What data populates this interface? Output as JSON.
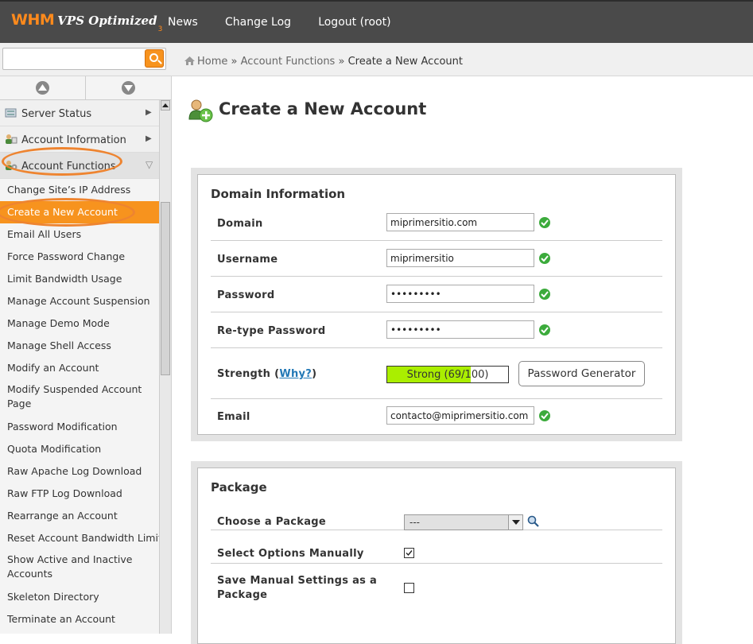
{
  "header": {
    "logo_main": "WHM",
    "logo_sub": "VPS Optimized",
    "logo_ver": "3",
    "nav": [
      "News",
      "Change Log",
      "Logout (root)"
    ]
  },
  "search": {
    "value": "",
    "placeholder": ""
  },
  "breadcrumb": {
    "home": "Home",
    "sep": "»",
    "section": "Account Functions",
    "current": "Create a New Account"
  },
  "sidebar": {
    "sections": [
      {
        "label": "Server Status",
        "caret": "▶"
      },
      {
        "label": "Account Information",
        "caret": "▶"
      },
      {
        "label": "Account Functions",
        "caret": "▽"
      }
    ],
    "items": [
      "Change Site’s IP Address",
      "Create a New Account",
      "Email All Users",
      "Force Password Change",
      "Limit Bandwidth Usage",
      "Manage Account Suspension",
      "Manage Demo Mode",
      "Manage Shell Access",
      "Modify an Account",
      "Modify Suspended Account Page",
      "Password Modification",
      "Quota Modification",
      "Raw Apache Log Download",
      "Raw FTP Log Download",
      "Rearrange an Account",
      "Reset Account Bandwidth Limit",
      "Show Active and Inactive Accounts",
      "Skeleton Directory",
      "Terminate an Account"
    ],
    "selected_item": "Create a New Account",
    "scroll_position": 0.19
  },
  "page": {
    "title": "Create a New Account"
  },
  "domain_info": {
    "heading": "Domain Information",
    "domain_label": "Domain",
    "domain_value": "miprimersitio.com",
    "username_label": "Username",
    "username_value": "miprimersitio",
    "password_label": "Password",
    "password_value": "•••••••••",
    "retype_label": "Re-type Password",
    "retype_value": "•••••••••",
    "strength_label": "Strength",
    "strength_why": "Why?",
    "strength_text": "Strong (69/100)",
    "strength_score": 69,
    "generator_button": "Password Generator",
    "email_label": "Email",
    "email_value": "contacto@miprimersitio.com"
  },
  "package": {
    "heading": "Package",
    "choose_label": "Choose a Package",
    "choose_value": "---",
    "manual_label": "Select Options Manually",
    "manual_checked": true,
    "save_label_line1": "Save Manual Settings as a",
    "save_label_line2": "Package",
    "save_checked": false
  },
  "colors": {
    "accent": "#f7931e",
    "success": "#3cab3c",
    "strength_fill": "#aaee00",
    "link": "#2278b6",
    "topbar": "#4a4a4a"
  }
}
